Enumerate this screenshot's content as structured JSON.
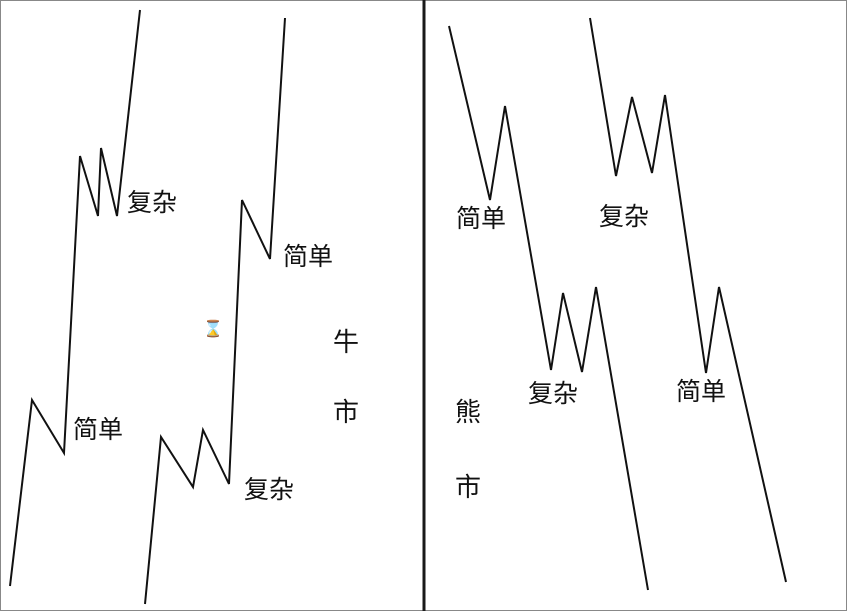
{
  "colors": {
    "line": "#111111",
    "divider": "#1a1a1a",
    "frame": "#888888",
    "background": "#ffffff"
  },
  "left_panel": {
    "labels": {
      "simple_1": "简单",
      "complex_1": "复杂",
      "simple_2": "简单",
      "complex_2": "复杂"
    },
    "vertical_char_1": "牛",
    "vertical_char_2": "市",
    "small_icon": "hourglass-icon"
  },
  "right_panel": {
    "labels": {
      "simple_1": "简单",
      "complex_1": "复杂",
      "complex_2": "复杂",
      "simple_2": "简单"
    },
    "vertical_char_1": "熊",
    "vertical_char_2": "市"
  }
}
